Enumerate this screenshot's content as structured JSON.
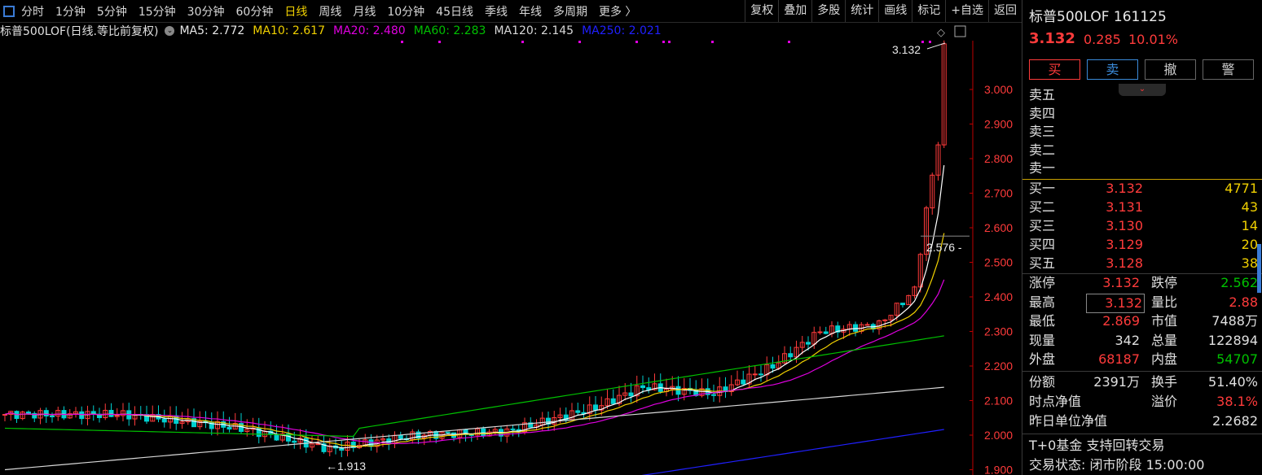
{
  "toolbar": {
    "periods": [
      "分时",
      "1分钟",
      "5分钟",
      "15分钟",
      "30分钟",
      "60分钟",
      "日线",
      "周线",
      "月线",
      "10分钟",
      "45日线",
      "季线",
      "年线",
      "多周期",
      "更多 〉"
    ],
    "active_period": "日线",
    "tools": [
      "复权",
      "叠加",
      "多股",
      "统计",
      "画线",
      "标记",
      "+自选",
      "返回"
    ]
  },
  "ma_bar": {
    "title": "标普500LOF(日线.等比前复权)",
    "items": [
      {
        "label": "MA5: 2.772",
        "color": "#e8e8e8"
      },
      {
        "label": "MA10: 2.617",
        "color": "#f0d000"
      },
      {
        "label": "MA20: 2.480",
        "color": "#e000e0"
      },
      {
        "label": "MA60: 2.283",
        "color": "#00c000"
      },
      {
        "label": "MA120: 2.145",
        "color": "#d8d8d8"
      },
      {
        "label": "MA250: 2.021",
        "color": "#2020ff"
      }
    ]
  },
  "chart_data": {
    "type": "candlestick",
    "y_ticks": [
      "3.000",
      "2.900",
      "2.800",
      "2.700",
      "2.600",
      "2.500",
      "2.400",
      "2.300",
      "2.200",
      "2.100",
      "2.000",
      "1.900"
    ],
    "ylim": [
      1.9,
      3.132
    ],
    "high_label": "3.132",
    "low_label": "1.913",
    "cursor_price": "2.576 -"
  },
  "quote": {
    "title": "标普500LOF 161125",
    "price": "3.132",
    "change": "0.285",
    "pct": "10.01%",
    "buttons": [
      "买",
      "卖",
      "撤",
      "警"
    ],
    "asks": [
      {
        "label": "卖五",
        "price": "",
        "vol": ""
      },
      {
        "label": "卖四",
        "price": "",
        "vol": ""
      },
      {
        "label": "卖三",
        "price": "",
        "vol": ""
      },
      {
        "label": "卖二",
        "price": "",
        "vol": ""
      },
      {
        "label": "卖一",
        "price": "",
        "vol": ""
      }
    ],
    "bids": [
      {
        "label": "买一",
        "price": "3.132",
        "vol": "4771"
      },
      {
        "label": "买二",
        "price": "3.131",
        "vol": "43"
      },
      {
        "label": "买三",
        "price": "3.130",
        "vol": "14"
      },
      {
        "label": "买四",
        "price": "3.129",
        "vol": "20"
      },
      {
        "label": "买五",
        "price": "3.128",
        "vol": "38"
      }
    ],
    "stats": [
      {
        "l1": "涨停",
        "v1": "3.132",
        "c1": "#ff3b3b",
        "l2": "跌停",
        "v2": "2.562",
        "c2": "#00c000"
      },
      {
        "l1": "最高",
        "v1": "3.132",
        "c1": "#ff3b3b",
        "l2": "量比",
        "v2": "2.88",
        "c2": "#ff3b3b"
      },
      {
        "l1": "最低",
        "v1": "2.869",
        "c1": "#ff3b3b",
        "l2": "市值",
        "v2": "7488万",
        "c2": "#e0e0e0"
      },
      {
        "l1": "现量",
        "v1": "342",
        "c1": "#e0e0e0",
        "l2": "总量",
        "v2": "122894",
        "c2": "#e0e0e0"
      },
      {
        "l1": "外盘",
        "v1": "68187",
        "c1": "#ff3b3b",
        "l2": "内盘",
        "v2": "54707",
        "c2": "#00c000"
      }
    ],
    "fund": [
      {
        "l1": "份额",
        "v1": "2391万",
        "c1": "#e0e0e0",
        "l2": "换手",
        "v2": "51.40%",
        "c2": "#e0e0e0"
      },
      {
        "l1": "时点净值",
        "v1": "",
        "c1": "#e0e0e0",
        "l2": "溢价",
        "v2": "38.1%",
        "c2": "#ff3b3b"
      }
    ],
    "nav_label": "昨日单位净值",
    "nav_value": "2.2682",
    "t0": "T+0基金  支持回转交易",
    "status": "交易状态: 闭市阶段 15:00:00"
  }
}
